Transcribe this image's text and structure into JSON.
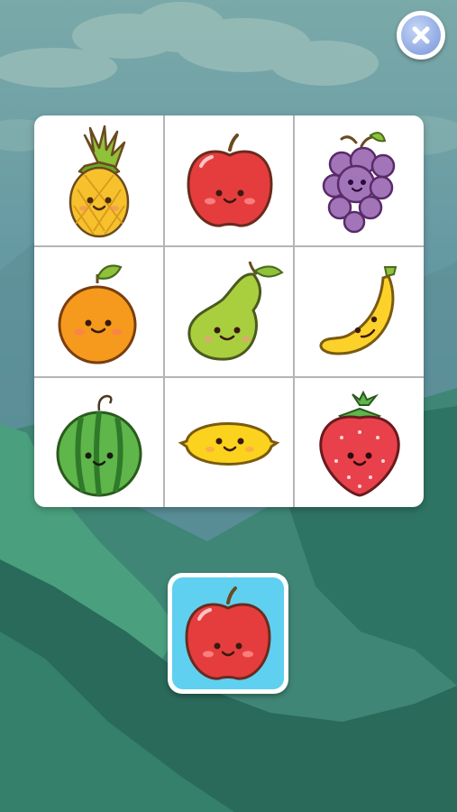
{
  "scene": {
    "sky_color": "#6f9fa2",
    "mountain_color": "#2f7a6a"
  },
  "close_button": {
    "icon": "close-icon",
    "color": "#8ea8e2"
  },
  "board": {
    "rows": 3,
    "cols": 3,
    "cells": [
      {
        "fruit": "pineapple"
      },
      {
        "fruit": "apple"
      },
      {
        "fruit": "grapes"
      },
      {
        "fruit": "orange"
      },
      {
        "fruit": "pear"
      },
      {
        "fruit": "banana"
      },
      {
        "fruit": "watermelon"
      },
      {
        "fruit": "lemon"
      },
      {
        "fruit": "strawberry"
      }
    ]
  },
  "target": {
    "fruit": "apple",
    "background": "#5fd0f0"
  }
}
